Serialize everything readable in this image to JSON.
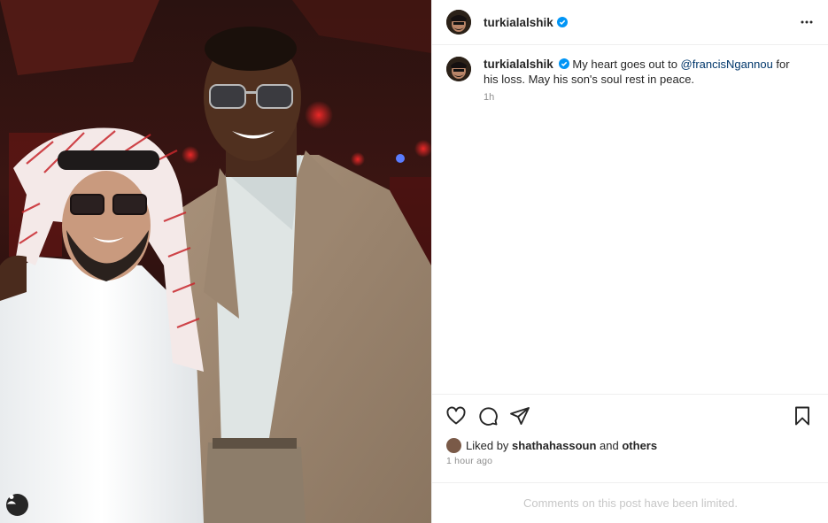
{
  "post": {
    "author": "turkialalshik",
    "verified": true,
    "caption_author": "turkialalshik",
    "caption_before": "My heart goes out to ",
    "caption_mention": "@francisNgannou",
    "caption_after": " for his loss. May his son's soul rest in peace.",
    "caption_time": "1h",
    "liked_by_prefix": "Liked by ",
    "liked_by_user": "shathahassoun",
    "liked_by_and": " and ",
    "liked_by_others": "others",
    "time_ago": "1 hour ago",
    "comments_limited": "Comments on this post have been limited."
  },
  "icons": {
    "more": "more-dots-icon",
    "like": "heart-icon",
    "comment": "comment-bubble-icon",
    "share": "paper-plane-icon",
    "save": "bookmark-icon",
    "user_tags": "user-tag-icon",
    "verified": "verified-badge-icon"
  },
  "colors": {
    "verified_blue": "#0095f6",
    "mention": "#00376b",
    "muted": "#8e8e8e",
    "limited_text": "#c7c7c7"
  }
}
